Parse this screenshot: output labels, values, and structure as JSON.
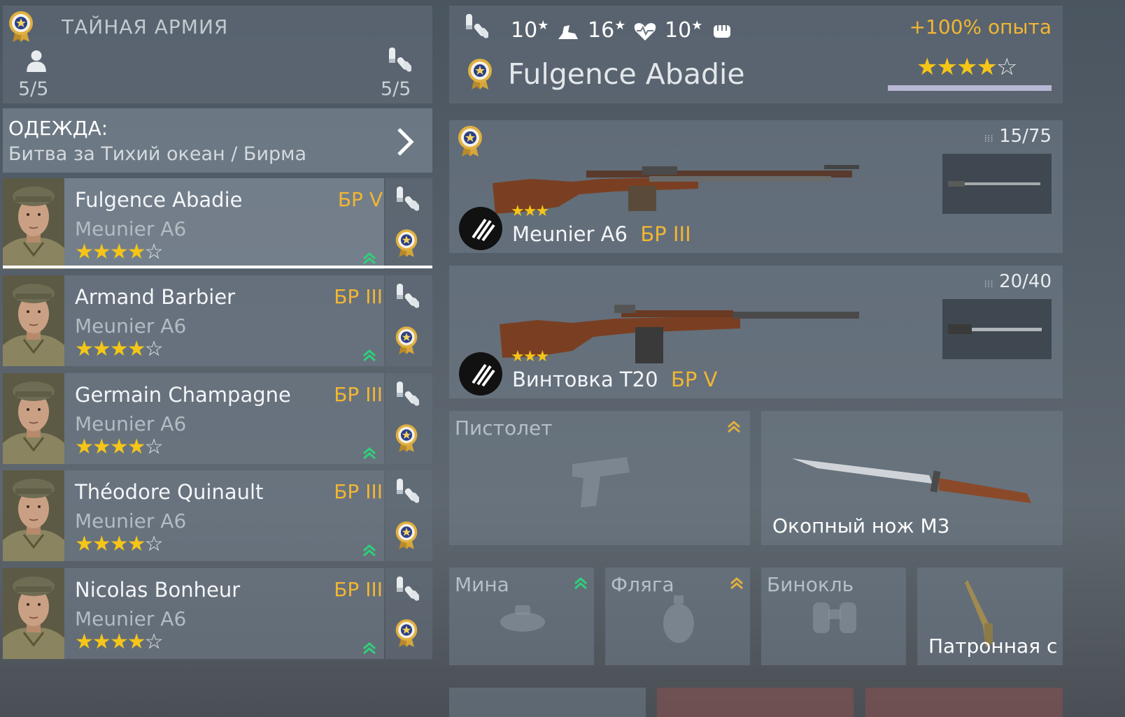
{
  "squad": {
    "title": "ТАЙНАЯ АРМИЯ",
    "soldiers_count": "5/5",
    "ammo_count": "5/5"
  },
  "outfit": {
    "label": "ОДЕЖДА:",
    "value": "Битва за Тихий океан / Бирма"
  },
  "soldiers": [
    {
      "name": "Fulgence Abadie",
      "weapon": "Meunier A6",
      "rank": "БР V",
      "stars": 4
    },
    {
      "name": "Armand Barbier",
      "weapon": "Meunier A6",
      "rank": "БР III",
      "stars": 4
    },
    {
      "name": "Germain Champagne",
      "weapon": "Meunier A6",
      "rank": "БР III",
      "stars": 4
    },
    {
      "name": "Théodore Quinault",
      "weapon": "Meunier A6",
      "rank": "БР III",
      "stars": 4
    },
    {
      "name": "Nicolas Bonheur",
      "weapon": "Meunier A6",
      "rank": "БР III",
      "stars": 4
    }
  ],
  "selected": {
    "name": "Fulgence Abadie",
    "stat1": "10",
    "stat2": "16",
    "stat3": "10",
    "exp_bonus": "+100% опыта",
    "stars": 4
  },
  "weapons": [
    {
      "name": "Meunier A6",
      "rank": "БР III",
      "ammo": "15/75",
      "stars": 3
    },
    {
      "name": "Винтовка T20",
      "rank": "БР V",
      "ammo": "20/40",
      "stars": 3
    }
  ],
  "slots": {
    "pistol": "Пистолет",
    "knife": "Окопный нож М3",
    "mine": "Мина",
    "flask": "Фляга",
    "binoculars": "Бинокль",
    "belt": "Патронная с"
  },
  "colors": {
    "gold": "#f2b632",
    "star": "#f5c518",
    "upgrade_green": "#2fd07a",
    "upgrade_gold": "#e0b040"
  }
}
